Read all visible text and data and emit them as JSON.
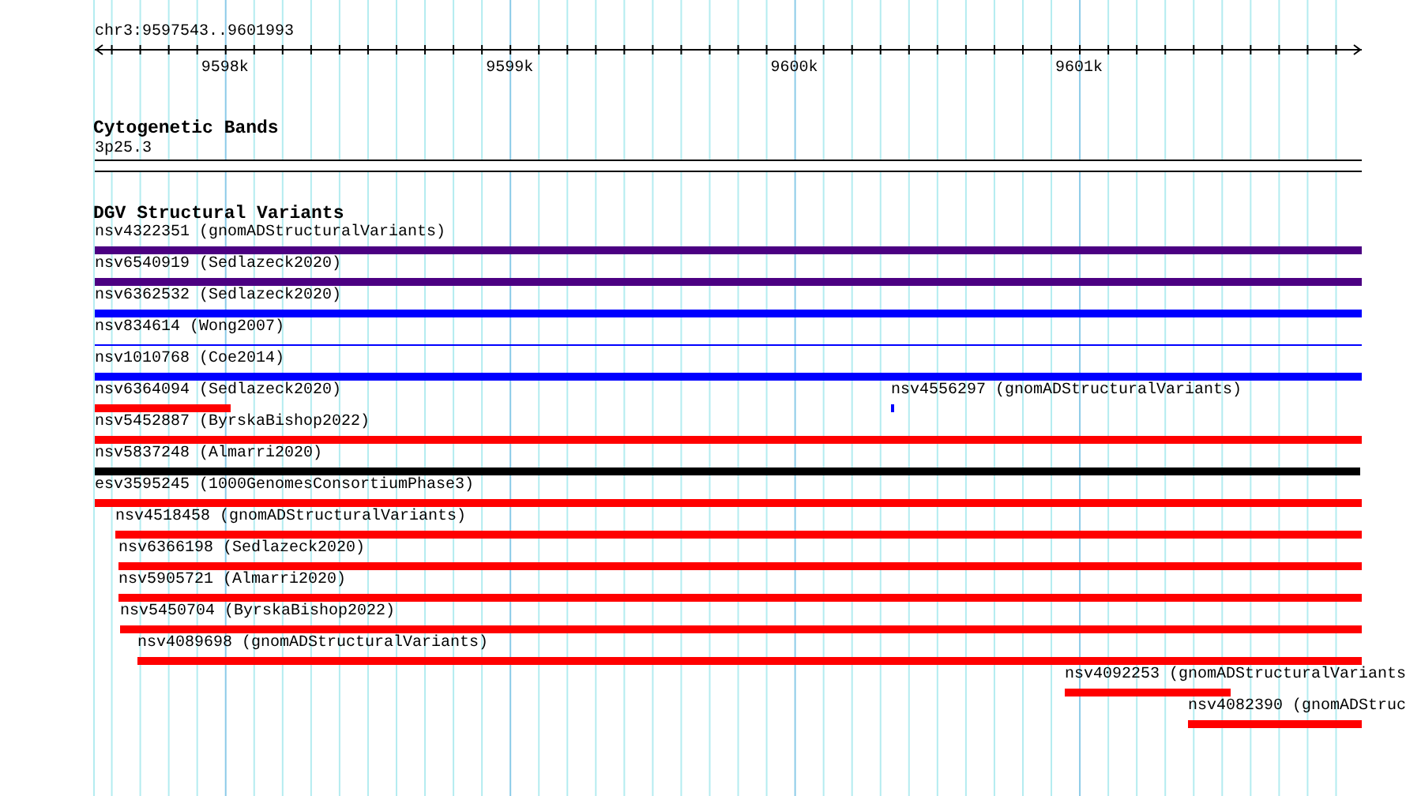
{
  "location": "chr3:9597543..9601993",
  "ruler": {
    "labels": [
      "9598k",
      "9599k",
      "9600k",
      "9601k"
    ]
  },
  "tracks": [
    {
      "kind": "cytoband",
      "title": "Cytogenetic Bands",
      "band": {
        "name": "3p25.3"
      }
    },
    {
      "kind": "variants",
      "title": "DGV Structural Variants",
      "rows": [
        [
          {
            "label": "nsv4322351 (gnomADStructuralVariants)",
            "color": "#4b0082",
            "kind": "bar"
          }
        ],
        [
          {
            "label": "nsv6540919 (Sedlazeck2020)",
            "color": "#4b0082",
            "kind": "bar"
          }
        ],
        [
          {
            "label": "nsv6362532 (Sedlazeck2020)",
            "color": "#0000ff",
            "kind": "bar"
          }
        ],
        [
          {
            "label": "nsv834614 (Wong2007)",
            "color": "#0000ff",
            "kind": "line"
          }
        ],
        [
          {
            "label": "nsv1010768 (Coe2014)",
            "color": "#0000ff",
            "kind": "bar"
          }
        ],
        [
          {
            "label": "nsv6364094 (Sedlazeck2020)",
            "color": "#ff0000",
            "kind": "bar"
          },
          {
            "label": "nsv4556297 (gnomADStructuralVariants)",
            "color": "#0000ff",
            "kind": "bar"
          }
        ],
        [
          {
            "label": "nsv5452887 (ByrskaBishop2022)",
            "color": "#ff0000",
            "kind": "bar"
          }
        ],
        [
          {
            "label": "nsv5837248 (Almarri2020)",
            "color": "#000000",
            "kind": "bar"
          }
        ],
        [
          {
            "label": "esv3595245 (1000GenomesConsortiumPhase3)",
            "color": "#ff0000",
            "kind": "bar"
          }
        ],
        [
          {
            "label": "nsv4518458 (gnomADStructuralVariants)",
            "color": "#ff0000",
            "kind": "bar"
          }
        ],
        [
          {
            "label": "nsv6366198 (Sedlazeck2020)",
            "color": "#ff0000",
            "kind": "bar"
          }
        ],
        [
          {
            "label": "nsv5905721 (Almarri2020)",
            "color": "#ff0000",
            "kind": "bar"
          }
        ],
        [
          {
            "label": "nsv5450704 (ByrskaBishop2022)",
            "color": "#ff0000",
            "kind": "bar"
          }
        ],
        [
          {
            "label": "nsv4089698 (gnomADStructuralVariants)",
            "color": "#ff0000",
            "kind": "bar"
          }
        ],
        [
          {
            "label": "nsv4092253 (gnomADStructuralVariants",
            "color": "#ff0000",
            "kind": "bar"
          }
        ],
        [
          {
            "label": "nsv4082390 (gnomADStruc",
            "color": "#ff0000",
            "kind": "bar"
          }
        ]
      ]
    }
  ]
}
